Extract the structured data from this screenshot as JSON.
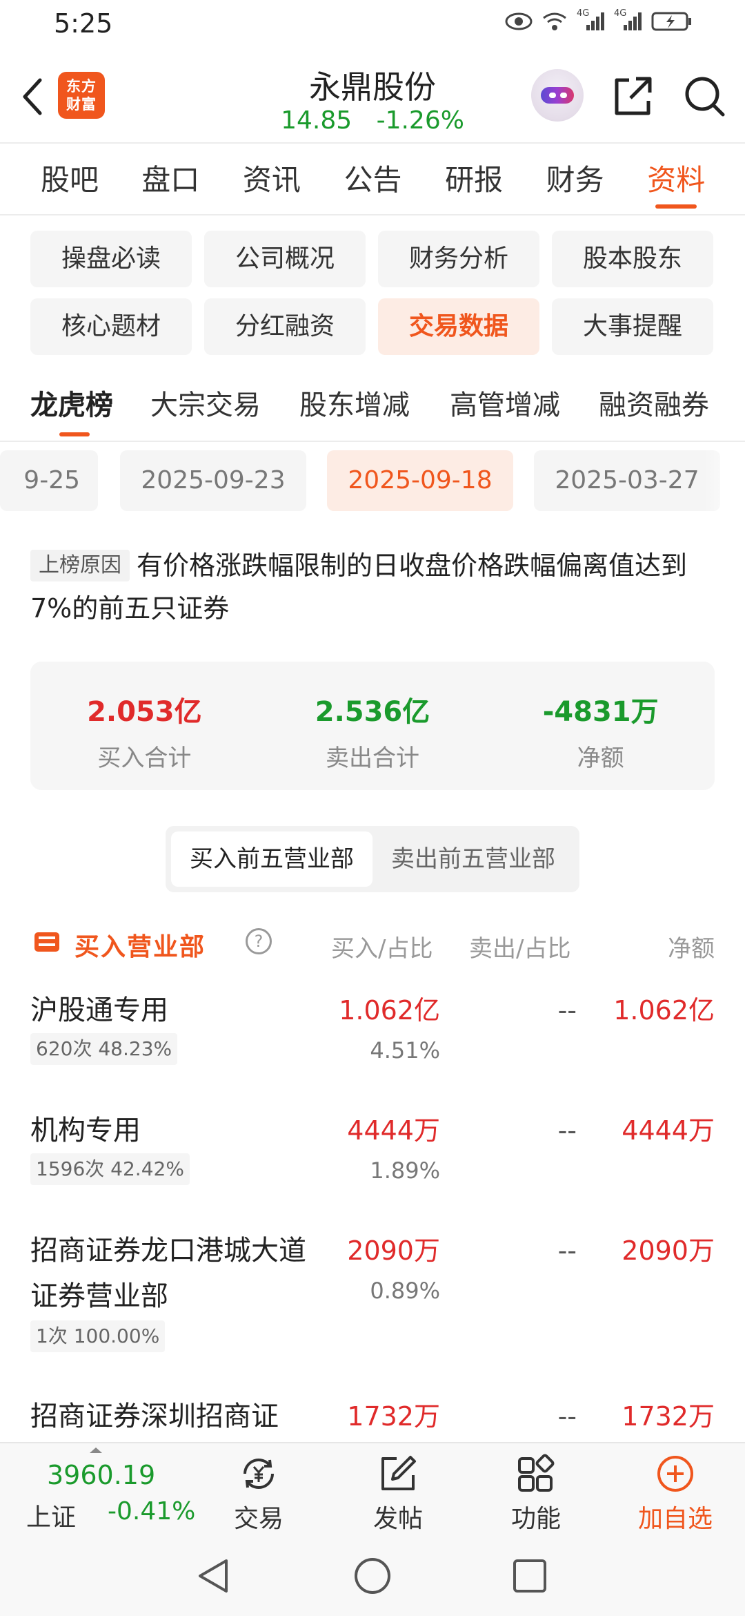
{
  "status_bar": {
    "time": "5:25",
    "net1": "4G",
    "net2": "4G"
  },
  "header": {
    "logo_line1": "东方",
    "logo_line2": "财富",
    "stock_name": "永鼎股份",
    "price": "14.85",
    "change": "-1.26%"
  },
  "main_tabs": [
    {
      "label": "股吧"
    },
    {
      "label": "盘口"
    },
    {
      "label": "资讯"
    },
    {
      "label": "公告"
    },
    {
      "label": "研报"
    },
    {
      "label": "财务"
    },
    {
      "label": "资料"
    }
  ],
  "chips": [
    {
      "label": "操盘必读"
    },
    {
      "label": "公司概况"
    },
    {
      "label": "财务分析"
    },
    {
      "label": "股本股东"
    },
    {
      "label": "核心题材"
    },
    {
      "label": "分红融资"
    },
    {
      "label": "交易数据"
    },
    {
      "label": "大事提醒"
    }
  ],
  "sub_tabs": [
    {
      "label": "龙虎榜"
    },
    {
      "label": "大宗交易"
    },
    {
      "label": "股东增减"
    },
    {
      "label": "高管增减"
    },
    {
      "label": "融资融券"
    }
  ],
  "dates": [
    {
      "label": "9-25"
    },
    {
      "label": "2025-09-23"
    },
    {
      "label": "2025-09-18"
    },
    {
      "label": "2025-03-27"
    }
  ],
  "reason": {
    "tag": "上榜原因",
    "text": "有价格涨跌幅限制的日收盘价格跌幅偏离值达到7%的前五只证券"
  },
  "summary": {
    "buy_value": "2.053亿",
    "buy_label": "买入合计",
    "sell_value": "2.536亿",
    "sell_label": "卖出合计",
    "net_value": "-4831万",
    "net_label": "净额"
  },
  "segment": {
    "buy_top5": "买入前五营业部",
    "sell_top5": "卖出前五营业部"
  },
  "table": {
    "title": "买入营业部",
    "help": "?",
    "col_buy": "买入/占比",
    "col_sell": "卖出/占比",
    "col_net": "净额",
    "rows": [
      {
        "name": "沪股通专用",
        "tag": "620次  48.23%",
        "buy": "1.062亿",
        "buy_pct": "4.51%",
        "sell": "--",
        "net": "1.062亿"
      },
      {
        "name": "机构专用",
        "tag": "1596次  42.42%",
        "buy": "4444万",
        "buy_pct": "1.89%",
        "sell": "--",
        "net": "4444万"
      },
      {
        "name": "招商证券龙口港城大道证券营业部",
        "tag": "1次  100.00%",
        "buy": "2090万",
        "buy_pct": "0.89%",
        "sell": "--",
        "net": "2090万"
      },
      {
        "name": "招商证券深圳招商证",
        "buy": "1732万",
        "sell": "--",
        "net": "1732万"
      }
    ]
  },
  "bottom_nav": {
    "index_value": "3960.19",
    "index_name": "上证",
    "index_change": "-0.41%",
    "trade": "交易",
    "post": "发帖",
    "functions": "功能",
    "add_watch": "加自选"
  },
  "colors": {
    "accent": "#f0561d",
    "up": "#e02a2a",
    "down": "#1a9a2c"
  }
}
